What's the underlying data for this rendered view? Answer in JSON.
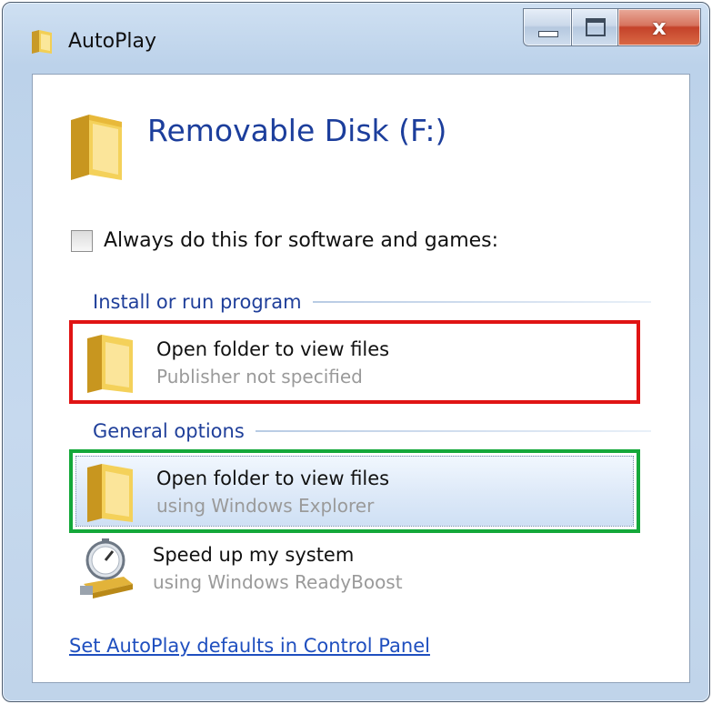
{
  "window": {
    "title": "AutoPlay",
    "close_glyph": "x"
  },
  "device": {
    "title": "Removable Disk (F:)"
  },
  "always_checkbox": {
    "label": "Always do this for software and games:",
    "checked": false
  },
  "groups": {
    "install": {
      "label": "Install or run program",
      "options": [
        {
          "title": "Open folder to view files",
          "subtitle": "Publisher not specified",
          "icon": "folder-icon",
          "highlight": "#e01414"
        }
      ]
    },
    "general": {
      "label": "General options",
      "options": [
        {
          "title": "Open folder to view files",
          "subtitle": "using Windows Explorer",
          "icon": "folder-icon",
          "highlight": "#14a83a"
        },
        {
          "title": "Speed up my system",
          "subtitle": "using Windows ReadyBoost",
          "icon": "readyboost-icon"
        }
      ]
    }
  },
  "footer_link": "Set AutoPlay defaults in Control Panel"
}
